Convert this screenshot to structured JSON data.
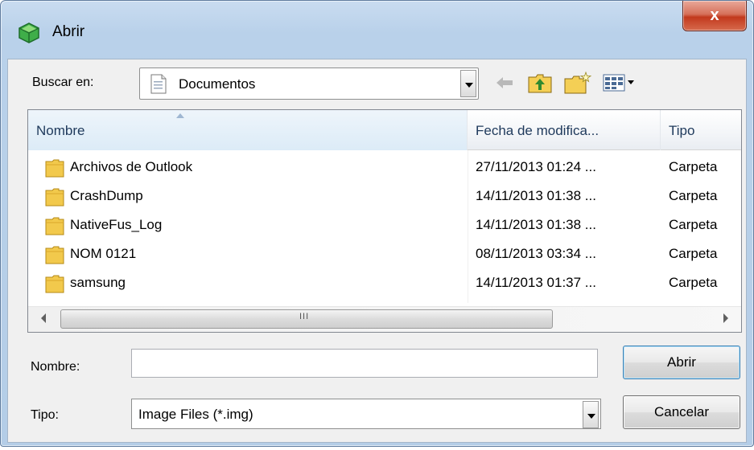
{
  "window": {
    "title": "Abrir",
    "close_label": "x"
  },
  "lookin": {
    "label": "Buscar en:",
    "value": "Documentos"
  },
  "columns": {
    "name": "Nombre",
    "date": "Fecha de modifica...",
    "type": "Tipo"
  },
  "files": [
    {
      "name": "Archivos de Outlook",
      "date": "27/11/2013 01:24 ...",
      "type": "Carpeta"
    },
    {
      "name": "CrashDump",
      "date": "14/11/2013 01:38 ...",
      "type": "Carpeta"
    },
    {
      "name": "NativeFus_Log",
      "date": "14/11/2013 01:38 ...",
      "type": "Carpeta"
    },
    {
      "name": "NOM 0121",
      "date": "08/11/2013 03:34 ...",
      "type": "Carpeta"
    },
    {
      "name": "samsung",
      "date": "14/11/2013 01:37 ...",
      "type": "Carpeta"
    }
  ],
  "scroll": {
    "grip": "III"
  },
  "filename": {
    "label": "Nombre:",
    "value": ""
  },
  "filetype": {
    "label": "Tipo:",
    "value": "Image Files (*.img)"
  },
  "buttons": {
    "open": "Abrir",
    "cancel": "Cancelar"
  },
  "colors": {
    "folder": "#f2c94c",
    "title_bar": "#b9d1ea",
    "close": "#c2391d"
  }
}
